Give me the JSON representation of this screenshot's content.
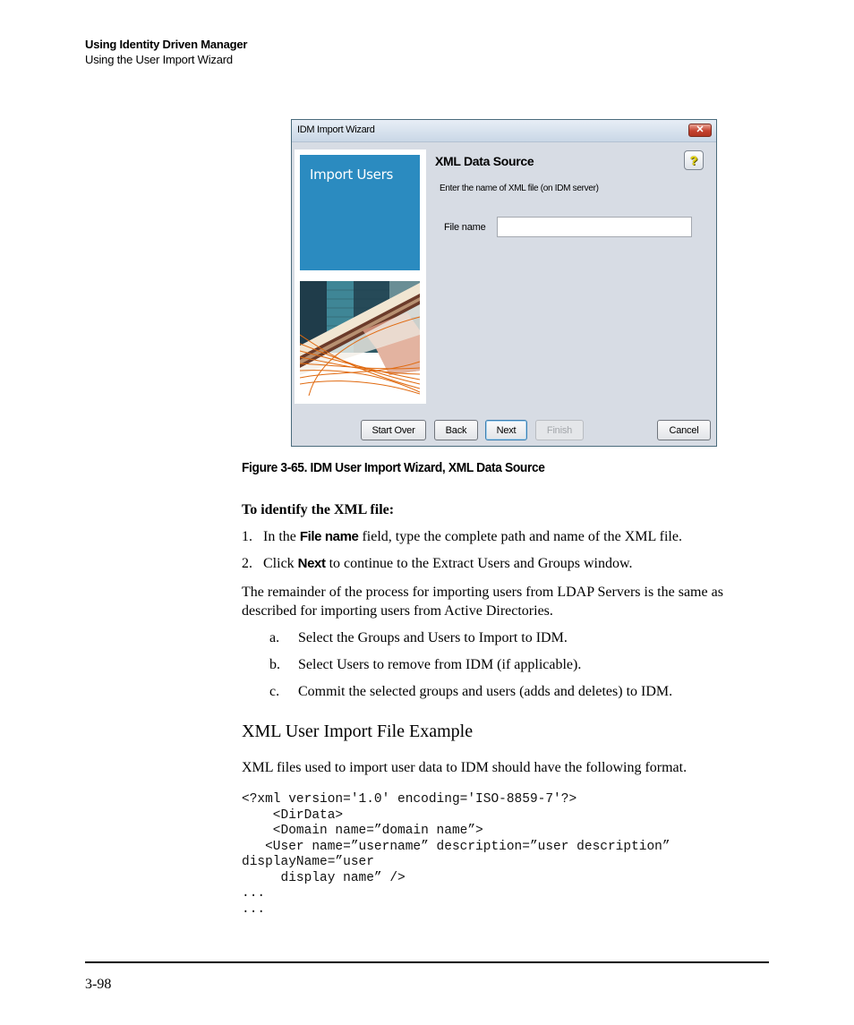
{
  "header": {
    "chapter": "Using Identity Driven Manager",
    "section": "Using the User Import Wizard"
  },
  "dialog": {
    "title": "IDM Import Wizard",
    "close_icon": "close-icon",
    "help_icon": "help-question-icon",
    "help_glyph": "?",
    "close_glyph": "✕",
    "side_label": "Import Users",
    "heading": "XML Data Source",
    "instruction": "Enter the name of XML file (on IDM server)",
    "file_name_label": "File name",
    "file_name_value": "",
    "buttons": {
      "start_over": "Start Over",
      "back": "Back",
      "next": "Next",
      "finish": "Finish",
      "cancel": "Cancel"
    }
  },
  "caption": "Figure 3-65. IDM User Import Wizard, XML Data Source",
  "procedure": {
    "title": "To identify the XML file:",
    "steps": [
      {
        "num": "1.",
        "pre": "In the ",
        "bold": "File name",
        "post": " field, type the complete path and name of the XML file."
      },
      {
        "num": "2.",
        "pre": "Click ",
        "bold": "Next",
        "post": " to continue to the Extract Users and Groups window."
      }
    ]
  },
  "remainder": {
    "line1": "The remainder of the process for importing users from LDAP Servers is the same as",
    "line2": "described for importing users from Active Directories.",
    "items": [
      {
        "letter": "a.",
        "text": "Select the Groups and Users to Import to IDM."
      },
      {
        "letter": "b.",
        "text": "Select Users to remove from IDM (if applicable)."
      },
      {
        "letter": "c.",
        "text": "Commit the selected groups and users (adds and deletes) to IDM."
      }
    ]
  },
  "xml_section": {
    "heading": "XML User Import File Example",
    "intro": "XML files used to import user data to IDM should have the following format.",
    "code": "<?xml version='1.0' encoding='ISO-8859-7'?>\n    <DirData>\n    <Domain name=”domain name”>\n   <User name=”username” description=”user description”\ndisplayName=”user\n     display name” />\n...\n..."
  },
  "footer": {
    "page_number": "3-98"
  }
}
